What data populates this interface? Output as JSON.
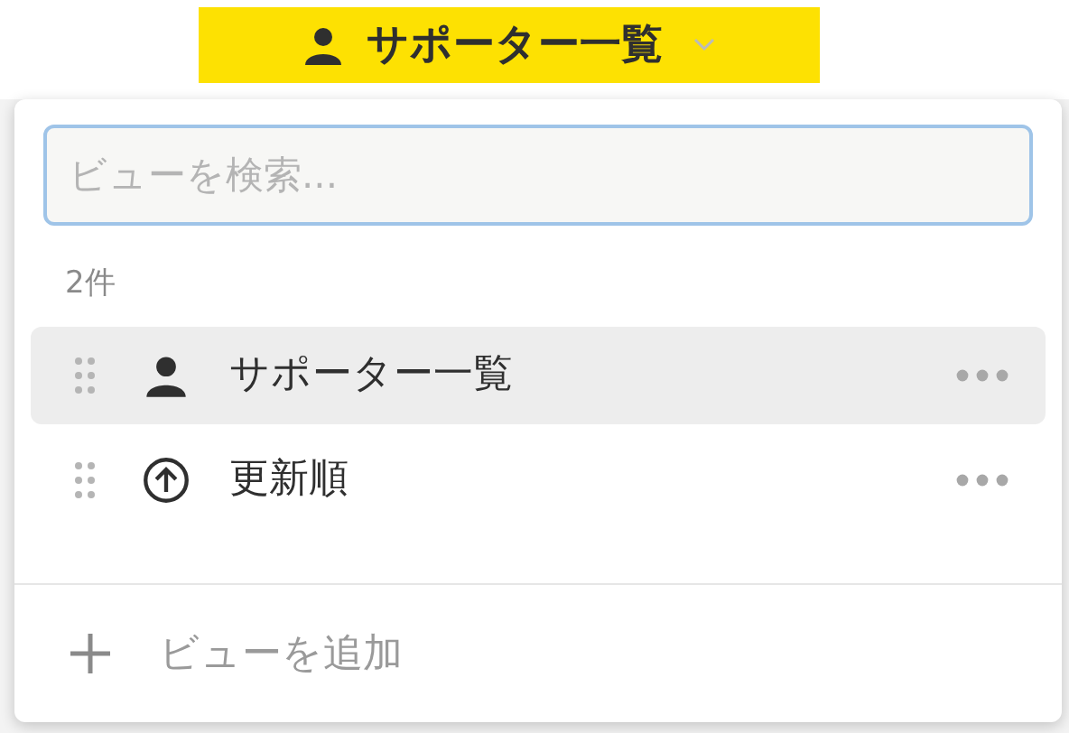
{
  "view_button": {
    "label": "サポーター一覧",
    "kind": "person"
  },
  "search": {
    "placeholder": "ビューを検索..."
  },
  "count": "2件",
  "views": [
    {
      "label": "サポーター一覧",
      "kind": "person",
      "selected": true
    },
    {
      "label": "更新順",
      "kind": "sort",
      "selected": false
    }
  ],
  "add_view": "ビューを追加"
}
